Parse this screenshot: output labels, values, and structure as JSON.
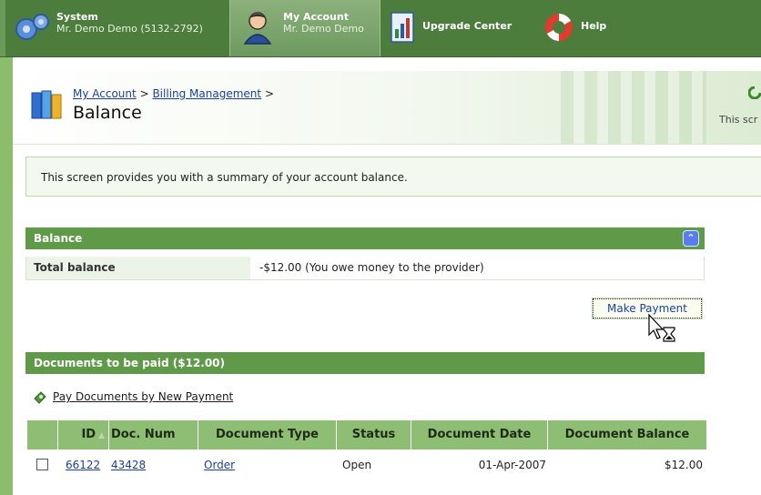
{
  "nav": {
    "system": {
      "title": "System",
      "subtitle": "Mr. Demo Demo (5132-2792)"
    },
    "my_account": {
      "title": "My Account",
      "subtitle": "Mr. Demo Demo"
    },
    "upgrade": {
      "title": "Upgrade Center"
    },
    "help": {
      "title": "Help"
    }
  },
  "header": {
    "breadcrumb": [
      {
        "label": "My Account"
      },
      {
        "label": "Billing Management"
      }
    ],
    "sep": ">",
    "title": "Balance",
    "hint_right": "This scr"
  },
  "info": "This screen provides you with a summary of your account balance.",
  "balance": {
    "section_title": "Balance",
    "label": "Total balance",
    "value": "-$12.00 (You owe money to the provider)"
  },
  "make_payment": "Make Payment",
  "documents": {
    "section_title": "Documents to be paid ($12.00)",
    "pay_link": "Pay Documents by New Payment",
    "columns": [
      "ID",
      "Doc. Num",
      "Document Type",
      "Status",
      "Document Date",
      "Document Balance"
    ],
    "rows": [
      {
        "id": "66122",
        "doc_num": "43428",
        "type": "Order",
        "status": "Open",
        "date": "01-Apr-2007",
        "balance": "$12.00"
      }
    ]
  },
  "colors": {
    "nav_green": "#4c7d3d",
    "section_green": "#5f9a49",
    "table_header": "#8ebd74",
    "link": "#1a3fa8"
  }
}
